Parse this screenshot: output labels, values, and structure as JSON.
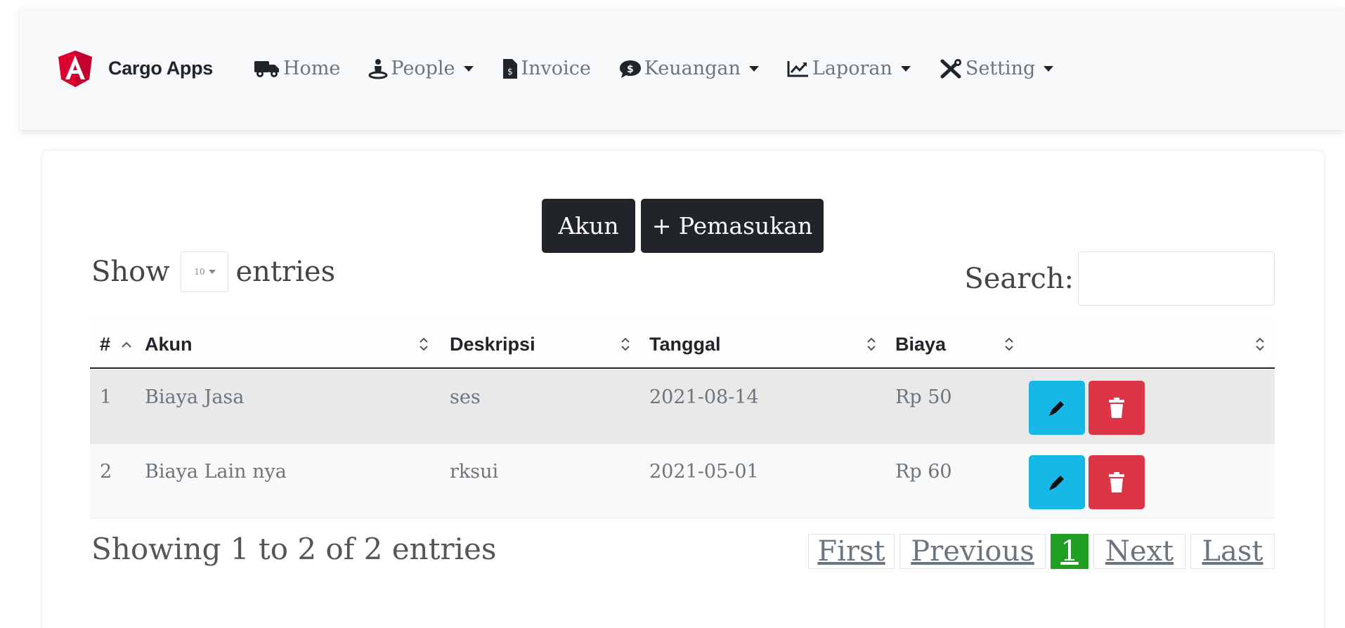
{
  "navbar": {
    "brand": "Cargo Apps",
    "items": [
      {
        "label": "Home",
        "icon": "truck-icon",
        "dropdown": false
      },
      {
        "label": "People",
        "icon": "person-icon",
        "dropdown": true
      },
      {
        "label": "Invoice",
        "icon": "file-invoice-icon",
        "dropdown": false
      },
      {
        "label": "Keuangan",
        "icon": "money-icon",
        "dropdown": true
      },
      {
        "label": "Laporan",
        "icon": "chart-line-icon",
        "dropdown": true
      },
      {
        "label": "Setting",
        "icon": "tools-icon",
        "dropdown": true
      }
    ]
  },
  "actions": {
    "akun_label": "Akun",
    "pemasukan_label": "+ Pemasukan"
  },
  "length": {
    "show_label": "Show",
    "value": "10",
    "entries_label": "entries"
  },
  "search": {
    "label": "Search:",
    "value": ""
  },
  "table": {
    "columns": [
      "#",
      "Akun",
      "Deskripsi",
      "Tanggal",
      "Biaya",
      ""
    ],
    "rows": [
      {
        "no": "1",
        "akun": "Biaya Jasa",
        "deskripsi": "ses",
        "tanggal": "2021-08-14",
        "biaya": "Rp 50"
      },
      {
        "no": "2",
        "akun": "Biaya Lain nya",
        "deskripsi": "rksui",
        "tanggal": "2021-05-01",
        "biaya": "Rp 60"
      }
    ]
  },
  "info": "Showing 1 to 2 of 2 entries",
  "pagination": {
    "first": "First",
    "previous": "Previous",
    "current": "1",
    "next": "Next",
    "last": "Last"
  },
  "colors": {
    "brand_red": "#dd0031",
    "dark_button": "#212529",
    "edit_button": "#17b8e8",
    "delete_button": "#dc3545",
    "pager_active": "#1f9e22"
  }
}
